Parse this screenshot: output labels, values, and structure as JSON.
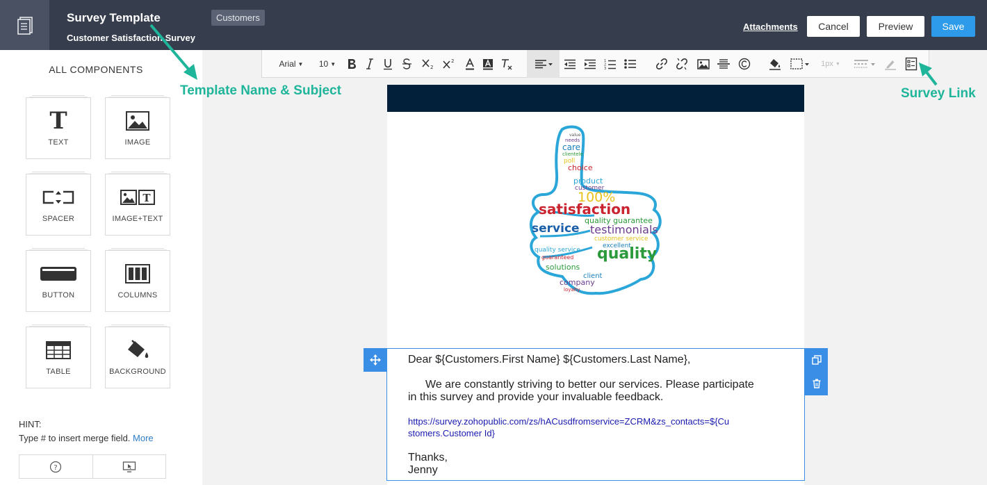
{
  "header": {
    "template_name": "Survey Template",
    "subject": "Customer Satisfaction Survey",
    "module": "Customers",
    "attachments": "Attachments",
    "cancel": "Cancel",
    "preview": "Preview",
    "save": "Save"
  },
  "sidebar": {
    "title": "ALL COMPONENTS",
    "components": [
      {
        "label": "TEXT",
        "icon": "text-icon"
      },
      {
        "label": "IMAGE",
        "icon": "image-icon"
      },
      {
        "label": "SPACER",
        "icon": "spacer-icon"
      },
      {
        "label": "IMAGE+TEXT",
        "icon": "image-text-icon"
      },
      {
        "label": "BUTTON",
        "icon": "button-icon"
      },
      {
        "label": "COLUMNS",
        "icon": "columns-icon"
      },
      {
        "label": "TABLE",
        "icon": "table-icon"
      },
      {
        "label": "BACKGROUND",
        "icon": "paint-bucket-icon"
      }
    ],
    "hint_title": "HINT:",
    "hint_text": "Type # to insert merge field.",
    "hint_more": "More"
  },
  "toolbar": {
    "font": "Arial",
    "size": "10",
    "border_width": "1px"
  },
  "annotations": {
    "template_name_subject": "Template Name & Subject",
    "survey_link": "Survey Link"
  },
  "email": {
    "greeting": "Dear ${Customers.First Name} ${Customers.Last Name},",
    "body_line1": "We are constantly striving to better our services. Please participate",
    "body_line2": "in this survey and provide your invaluable feedback.",
    "link_line1": "https://survey.zohopublic.com/zs/hACusdfromservice=ZCRM&zs_contacts=${Cu",
    "link_line2": "stomers.Customer Id}",
    "thanks": "Thanks,",
    "signature": "Jenny"
  },
  "hero_words": [
    "value",
    "needs",
    "care",
    "clientele",
    "poll",
    "choice",
    "product",
    "customer",
    "100%",
    "satisfaction",
    "quality guarantee",
    "service",
    "testimonials",
    "customer service",
    "excellent",
    "quality",
    "quality service",
    "guaranteed",
    "solutions",
    "client",
    "company",
    "loyalty"
  ]
}
